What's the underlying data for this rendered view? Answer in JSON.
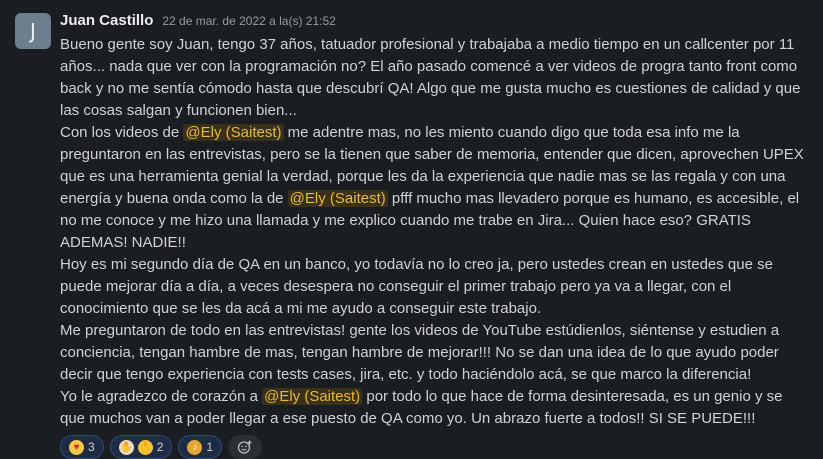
{
  "message": {
    "avatar_initial": "J",
    "author": "Juan Castillo",
    "timestamp": "22 de mar. de 2022 a la(s) 21:52",
    "mention": "@Ely (Saitest)",
    "p1": "Bueno gente soy Juan, tengo 37 años, tatuador profesional y trabajaba a medio tiempo en un callcenter por 11 años... nada que ver con la programación no?  El año pasado comencé a ver videos de progra tanto front como back y no me sentía cómodo hasta que descubrí QA!  Algo que me gusta mucho es cuestiones de calidad y que las cosas salgan y funcionen bien...",
    "p2_a": "Con los videos de ",
    "p2_b": " me adentre mas, no les miento cuando digo que toda esa info me la preguntaron en las entrevistas, pero se la tienen que saber de memoria, entender que dicen, aprovechen UPEX que es una herramienta genial la verdad, porque les da la experiencia que nadie mas se las regala y con una energía y buena onda como la de ",
    "p2_c": " pfff mucho mas llevadero porque es humano, es accesible, el no me conoce y me hizo una llamada y me explico cuando me trabe en Jira... Quien hace eso? GRATIS ADEMAS! NADIE!!",
    "p3": "Hoy es mi segundo día de QA en un banco, yo todavía no lo creo ja, pero ustedes crean en ustedes que se puede mejorar día a día, a veces desespera no conseguir el primer trabajo pero ya va a llegar, con el conocimiento que se les da acá a mi me ayudo a conseguir este trabajo.",
    "p4": "Me preguntaron de todo en las entrevistas! gente los videos de YouTube estúdienlos, siéntense y estudien a conciencia, tengan hambre de mas, tengan hambre de mejorar!!! No se dan una idea de lo que ayudo poder decir que tengo experiencia con tests cases, jira, etc. y todo haciéndolo acá, se que marco la diferencia!",
    "p5_a": "Yo le agradezco de corazón a ",
    "p5_b": " por todo lo que hace de forma desinteresada, es un genio y se que muchos van a poder llegar a ese puesto de QA como yo. Un abrazo fuerte a todos!! SI SE PUEDE!!!"
  },
  "reactions": [
    {
      "icon": "heart-eyes-emoji",
      "glyph": "♥",
      "count": "3"
    },
    {
      "icon": "clap-light-emoji",
      "icon2": "clap-yellow-emoji",
      "glyph": "✋",
      "count": "2"
    },
    {
      "icon": "beers-emoji",
      "glyph": "♪",
      "count": "1"
    }
  ],
  "colors": {
    "background": "#1a1d21",
    "mention_bg": "#3a311a",
    "mention_text": "#e8b83c",
    "reaction_bg": "#1e2b45",
    "reaction_border": "#2c4b7c"
  }
}
